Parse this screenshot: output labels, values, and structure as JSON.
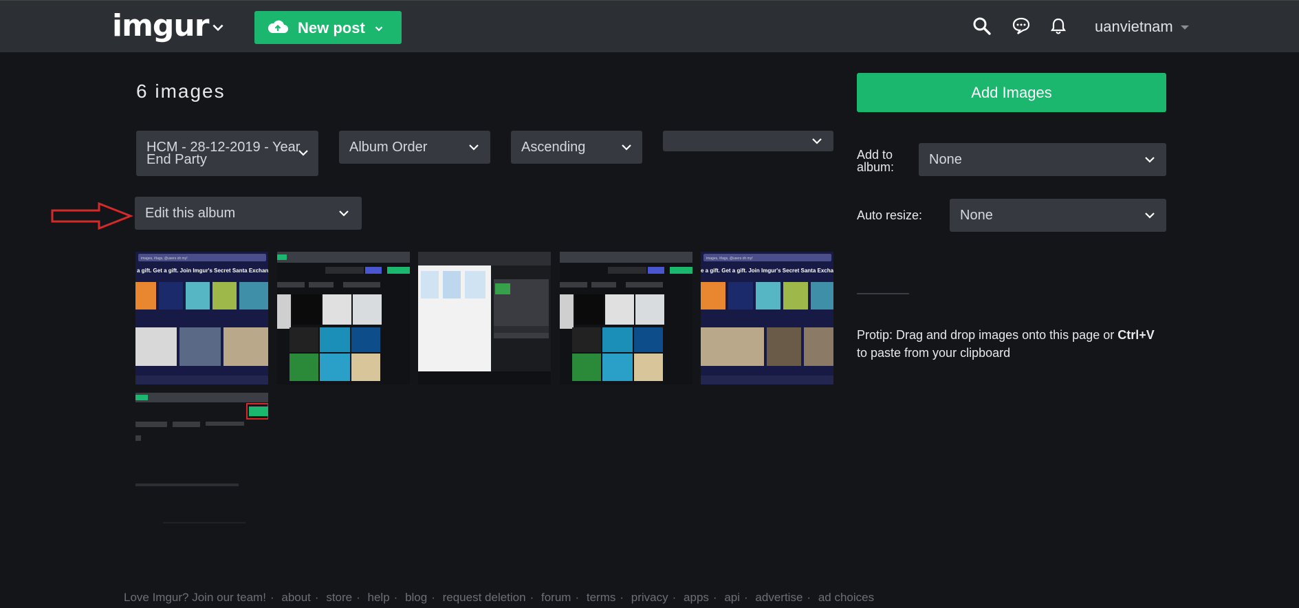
{
  "header": {
    "logo": "imgur",
    "new_post_label": "New post",
    "username": "uanvietnam"
  },
  "main": {
    "heading": "6 images",
    "filters": {
      "album_select": "HCM - 28-12-2019 - Year End Party",
      "sort_select": "Album Order",
      "order_select": "Ascending",
      "extra_select": ""
    },
    "edit_select": "Edit this album",
    "thumbnails": [
      {
        "top_text": "a gift. Get a gift. Join Imgur's Secret Santa Exchan",
        "search_placeholder": "images, #tags, @users oh my!"
      },
      {
        "top_text": "",
        "search_placeholder": ""
      },
      {
        "top_text": "",
        "search_placeholder": ""
      },
      {
        "top_text": "",
        "search_placeholder": ""
      },
      {
        "top_text": "e a gift. Get a gift. Join Imgur's Secret Santa Exchan",
        "search_placeholder": "images, #tags, @users oh my!"
      },
      {
        "top_text": "",
        "search_placeholder": ""
      }
    ]
  },
  "sidebar": {
    "add_images_label": "Add Images",
    "add_to_album_label": "Add to album:",
    "add_to_album_value": "None",
    "auto_resize_label": "Auto resize:",
    "auto_resize_value": "None",
    "protip_prefix": "Protip: Drag and drop images onto this page or",
    "protip_key": "Ctrl+V",
    "protip_suffix": "to paste from your clipboard"
  },
  "footer": {
    "links": [
      "Love Imgur? Join our team!",
      "about",
      "store",
      "help",
      "blog",
      "request deletion",
      "forum",
      "terms",
      "privacy",
      "apps",
      "api",
      "advertise",
      "ad choices"
    ]
  },
  "colors": {
    "background": "#141518",
    "topbar": "#2c2f34",
    "accent_green": "#1bb76e",
    "select_bg": "#36393f",
    "annotation_arrow": "#d42a2a"
  },
  "icons": {
    "logo_menu": "chevron-down-icon",
    "upload": "cloud-upload-icon",
    "search": "search-icon",
    "chat": "chat-bubble-icon",
    "notifications": "bell-icon"
  }
}
